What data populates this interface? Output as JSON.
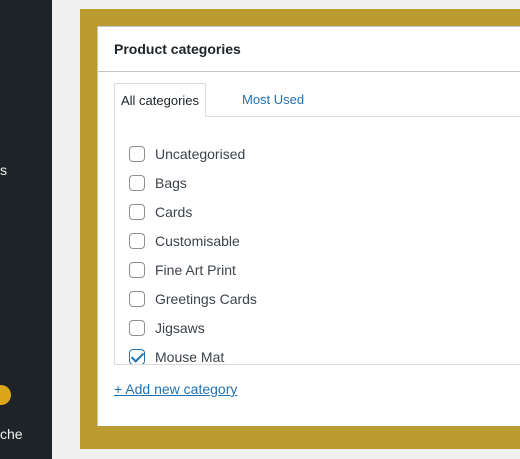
{
  "sidebar": {
    "fragment_1": "s",
    "fragment_2": "che"
  },
  "metabox": {
    "title": "Product categories",
    "tabs": [
      {
        "label": "All categories",
        "active": true
      },
      {
        "label": "Most Used",
        "active": false
      }
    ],
    "categories": [
      {
        "label": "Uncategorised",
        "checked": false
      },
      {
        "label": "Bags",
        "checked": false
      },
      {
        "label": "Cards",
        "checked": false
      },
      {
        "label": "Customisable",
        "checked": false
      },
      {
        "label": "Fine Art Print",
        "checked": false
      },
      {
        "label": "Greetings Cards",
        "checked": false
      },
      {
        "label": "Jigsaws",
        "checked": false
      },
      {
        "label": "Mouse Mat",
        "checked": true
      }
    ],
    "add_link": "+ Add new category"
  },
  "colors": {
    "sidebar_bg": "#1d2327",
    "highlight_frame": "#b99b30",
    "link": "#2271b1",
    "badge": "#dba617"
  }
}
